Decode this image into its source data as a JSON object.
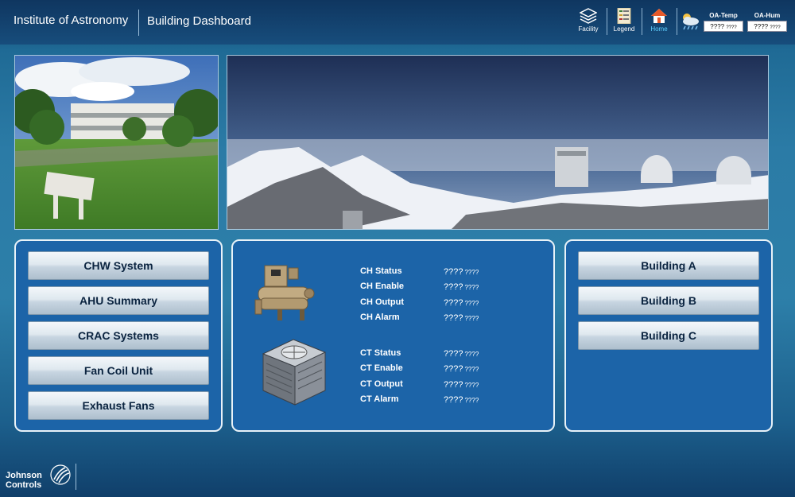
{
  "header": {
    "app_title": "Institute of Astronomy",
    "page_title": "Building Dashboard"
  },
  "nav": {
    "facility": "Facility",
    "legend": "Legend",
    "home": "Home"
  },
  "weather": {
    "temp_label": "OA-Temp",
    "temp_value": "????",
    "temp_unit": "????",
    "hum_label": "OA-Hum",
    "hum_value": "????",
    "hum_unit": "????"
  },
  "systems_menu": [
    "CHW System",
    "AHU Summary",
    "CRAC Systems",
    "Fan Coil Unit",
    "Exhaust Fans"
  ],
  "chiller": {
    "rows": [
      {
        "label": "CH Status",
        "value": "????",
        "unit": "????"
      },
      {
        "label": "CH Enable",
        "value": "????",
        "unit": "????"
      },
      {
        "label": "CH Output",
        "value": "????",
        "unit": "????"
      },
      {
        "label": "CH Alarm",
        "value": "????",
        "unit": "????"
      }
    ]
  },
  "tower": {
    "rows": [
      {
        "label": "CT Status",
        "value": "????",
        "unit": "????"
      },
      {
        "label": "CT Enable",
        "value": "????",
        "unit": "????"
      },
      {
        "label": "CT Output",
        "value": "????",
        "unit": "????"
      },
      {
        "label": "CT Alarm",
        "value": "????",
        "unit": "????"
      }
    ]
  },
  "buildings_menu": [
    "Building A",
    "Building B",
    "Building C"
  ],
  "footer": {
    "logo_line1": "Johnson",
    "logo_line2": "Controls"
  },
  "colors": {
    "panel_bg": "#1c64a8",
    "accent_home": "#5fd0ff"
  }
}
